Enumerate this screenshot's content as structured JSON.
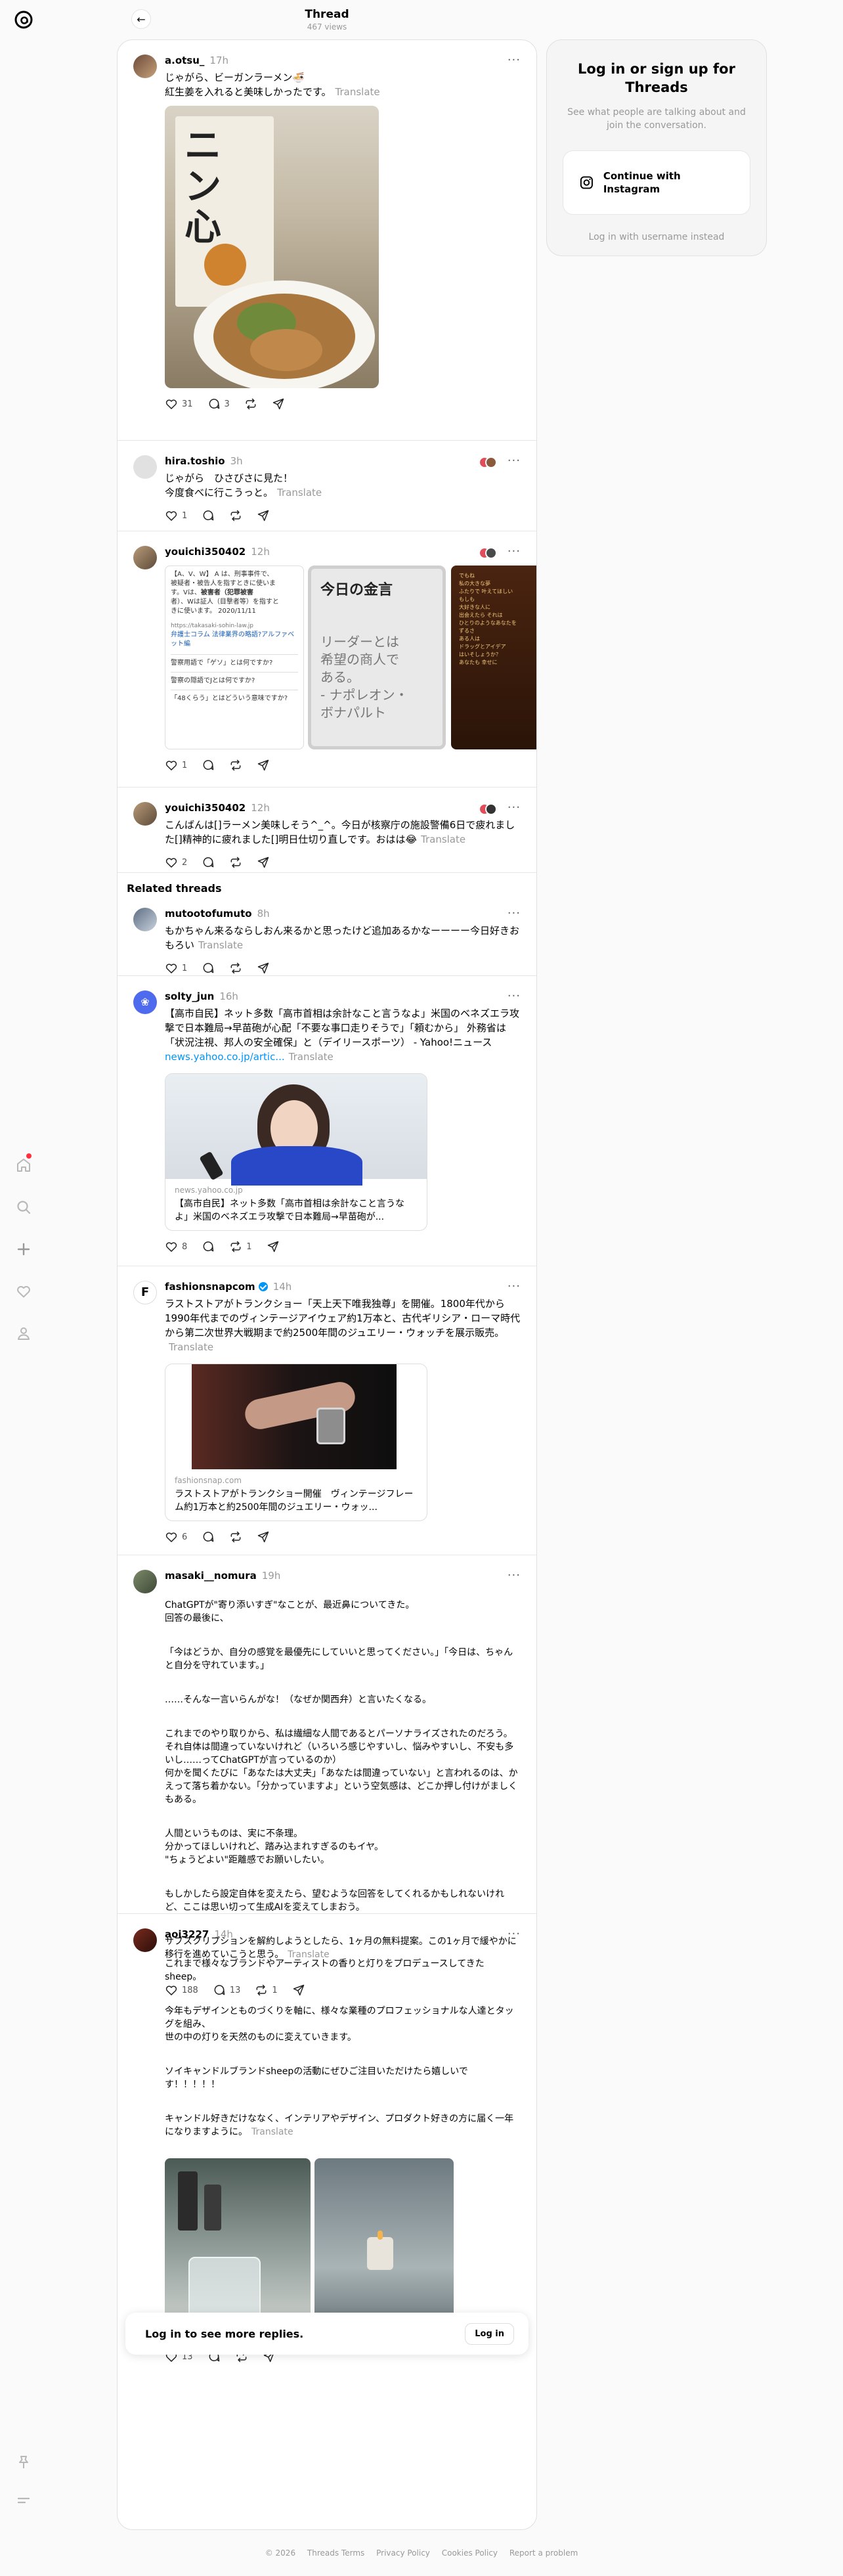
{
  "header": {
    "title": "Thread",
    "views": "467 views"
  },
  "posts": [
    {
      "username": "a.otsu_",
      "time": "17h",
      "text": "じゃがら、ビーガンラーメン🍜\n紅生姜を入れると美味しかったです。",
      "translate": "Translate",
      "likes": "31",
      "replies": "3"
    },
    {
      "username": "hira.toshio",
      "time": "3h",
      "text": "じゃがら　ひさびさに見た！\n今度食べに行こうっと。",
      "translate": "Translate",
      "likes": "1"
    },
    {
      "username": "youichi350402",
      "time": "12h",
      "likes": "1",
      "carousel": {
        "card1_lines": [
          "【A、V、W】 A は、刑事事件で、",
          "被疑者・被告人を指すときに使いま",
          "す。Vは、",
          "被害者（犯罪被害",
          "者）、Wは証人（目撃者等）を指すと",
          "きに使います。 2020/11/11"
        ],
        "card1_link": "弁護士コラム 法律業界の略語?アルファベット編",
        "card1_url": "https://takasaki-sohin-law.jp",
        "card1_faq": [
          "警察用語で「ゲソ」とは何ですか?",
          "警察の隠語でJとは何ですか?",
          "「48くらう」とはどういう意味ですか?"
        ],
        "card2_title": "今日の金言",
        "card2_quote": "リーダーとは\n希望の商人で\nある。\n- ナポレオン・\nボナパルト",
        "card3_lines": [
          "でもね",
          "私の大きな夢",
          "ふたりで 叶えてほしい",
          "",
          "もしも",
          "大好きな人に",
          "出会えたら それは",
          "ひとりのようなあなたを",
          "",
          "ずるさ",
          "ある人は",
          "ドラッグとアイデア",
          "はいそしょうか？",
          "",
          "あなたも 幸せに"
        ]
      }
    },
    {
      "username": "youichi350402",
      "time": "12h",
      "text": "こんばんは[]ラーメン美味しそう^_^。今日が核察庁の施設警備6日で疲れました[]精神的に疲れました[]明日仕切り直しです。おはは😂",
      "translate": "Translate",
      "likes": "2"
    }
  ],
  "related_title": "Related threads",
  "related": [
    {
      "username": "mutootofumuto",
      "time": "8h",
      "text": "もかちゃん来るならしおん来るかと思ったけど追加あるかなーーーー今日好きおもろい",
      "translate": "Translate",
      "likes": "1"
    },
    {
      "username": "solty_jun",
      "time": "16h",
      "text": "【高市自民】ネット多数「高市首相は余計なこと言うなよ」米国のベネズエラ攻撃で日本難局→早苗砲が心配「不要な事口走りそうで」「頼むから」 外務省は「状況注視、邦人の安全確保」と（デイリースポーツ） - Yahoo!ニュース",
      "link": "news.yahoo.co.jp/artic...",
      "translate": "Translate",
      "card_domain": "news.yahoo.co.jp",
      "card_title": "【高市自民】ネット多数「高市首相は余計なこと言うなよ」米国のベネズエラ攻撃で日本難局→早苗砲が...",
      "likes": "8",
      "reposts": "1"
    },
    {
      "username": "fashionsnapcom",
      "avatar_letter": "F",
      "time": "14h",
      "text": "ラストストアがトランクショー「天上天下唯我独尊」を開催。1800年代から1990年代までのヴィンテージアイウェア約1万本と、古代ギリシア・ローマ時代から第二次世界大戦期まで約2500年間のジュエリー・ウォッチを展示販売。",
      "translate": "Translate",
      "card_domain": "fashionsnap.com",
      "card_title": "ラストストアがトランクショー開催　ヴィンテージフレーム約1万本と約2500年間のジュエリー・ウォッ...",
      "likes": "6"
    },
    {
      "username": "masaki__nomura",
      "time": "19h",
      "paragraphs": [
        "ChatGPTが\"寄り添いすぎ\"なことが、最近鼻についてきた。\n回答の最後に、",
        "「今はどうか、自分の感覚を最優先にしていいと思ってください。」「今日は、ちゃんと自分を守れています。」",
        "……そんな一言いらんがな！（なぜか関西弁）と言いたくなる。",
        "これまでのやり取りから、私は繊細な人間であるとパーソナライズされたのだろう。\nそれ自体は間違っていないけれど（いろいろ感じやすいし、悩みやすいし、不安も多いし……ってChatGPTが言っているのか）\n何かを聞くたびに「あなたは大丈夫」「あなたは間違っていない」と言われるのは、かえって落ち着かない。「分かっていますよ」という空気感は、どこか押し付けがましくもある。",
        "人間というものは、実に不条理。\n分かってほしいけれど、踏み込まれすぎるのもイヤ。\n\"ちょうどよい\"距離感でお願いしたい。",
        "もしかしたら設定自体を変えたら、望むような回答をしてくれるかもしれないけれど、ここは思い切って生成AIを変えてしまおう。",
        "サブスクリプションを解約しようとしたら、1ヶ月の無料提案。この1ヶ月で緩やかに移行を進めていこうと思う。"
      ],
      "translate": "Translate",
      "likes": "188",
      "replies": "13",
      "reposts": "1"
    },
    {
      "username": "aoi3227",
      "time": "14h",
      "paragraphs": [
        "これまで様々なブランドやアーティストの香りと灯りをプロデュースしてきたsheep。",
        "今年もデザインとものづくりを軸に、様々な業種のプロフェッショナルな人達とタッグを組み、\n世の中の灯りを天然のものに変えていきます。",
        "ソイキャンドルブランドsheepの活動にぜひご注目いただけたら嬉しいです！！！！！",
        "キャンドル好きだけななく、インテリアやデザイン、プロダクト好きの方に届く一年になりますように。"
      ],
      "translate": "Translate",
      "likes": "13"
    }
  ],
  "login_bar": {
    "text": "Log in to see more replies.",
    "button": "Log in"
  },
  "login_card": {
    "title": "Log in or sign up for Threads",
    "subtitle": "See what people are talking about and join the conversation.",
    "instagram_button": "Continue with Instagram",
    "alt_login": "Log in with username instead"
  },
  "footer": {
    "copyright": "© 2026",
    "links": [
      "Threads Terms",
      "Privacy Policy",
      "Cookies Policy",
      "Report a problem"
    ]
  },
  "icons": {
    "logo": "threads-logo-icon",
    "nav": [
      "home-icon",
      "search-icon",
      "create-icon",
      "activity-icon",
      "profile-icon"
    ],
    "bottom": [
      "pin-icon",
      "menu-icon"
    ]
  },
  "colors": {
    "accent": "#0095f6",
    "notification": "#ff3040"
  }
}
